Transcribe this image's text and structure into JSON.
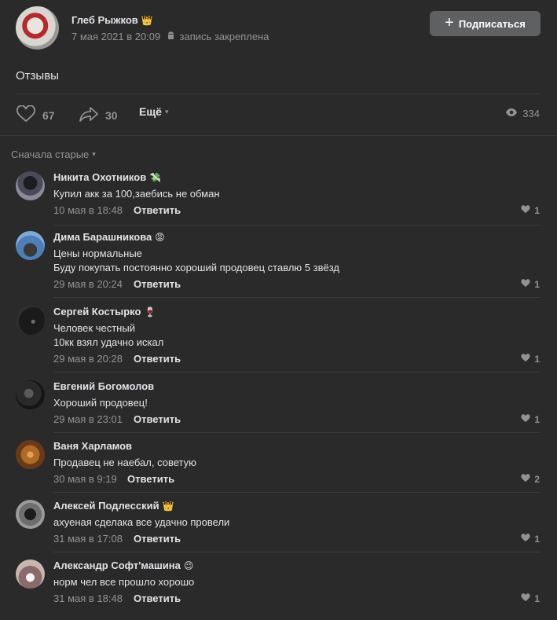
{
  "post": {
    "author": "Глеб Рыжков",
    "date": "7 мая 2021 в 20:09",
    "pinned": "запись закреплена",
    "subscribe_label": "Подписаться",
    "text": "Отзывы",
    "likes": "67",
    "shares": "30",
    "more_label": "Ещё",
    "views": "334"
  },
  "sort_label": "Сначала старые",
  "reply_label": "Ответить",
  "comments": [
    {
      "name": "Никита Охотников",
      "emoji": "💸",
      "lines": [
        "Купил акк за 100,заебись не обман"
      ],
      "date": "10 мая в 18:48",
      "likes": "1"
    },
    {
      "name": "Дима Барашникова",
      "emoji": "😡",
      "lines": [
        "Цены нормальные",
        "Буду покупать постоянно хороший продовец ставлю 5 звёзд"
      ],
      "date": "29 мая в 20:24",
      "likes": "1"
    },
    {
      "name": "Сергей Костырко",
      "emoji": "🍷",
      "lines": [
        "Человек честный",
        "10кк взял удачно искал"
      ],
      "date": "29 мая в 20:28",
      "likes": "1"
    },
    {
      "name": "Евгений Богомолов",
      "emoji": "",
      "lines": [
        "Хороший продовец!"
      ],
      "date": "29 мая в 23:01",
      "likes": "1"
    },
    {
      "name": "Ваня Харламов",
      "emoji": "",
      "lines": [
        "Продавец не наебал, советую"
      ],
      "date": "30 мая в 9:19",
      "likes": "2"
    },
    {
      "name": "Алексей Подлесский",
      "emoji": "👑",
      "lines": [
        "ахуеная сделака все удачно провели"
      ],
      "date": "31 мая в 17:08",
      "likes": "1"
    },
    {
      "name": "Александр Софт'машина",
      "emoji": "😉",
      "lines": [
        "норм чел все прошло хорошо"
      ],
      "date": "31 мая в 18:48",
      "likes": "1"
    }
  ]
}
